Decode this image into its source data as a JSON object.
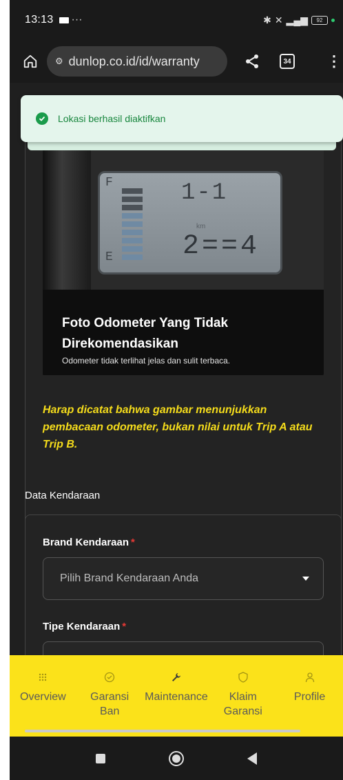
{
  "status_bar": {
    "time": "13:13",
    "battery": "92"
  },
  "browser": {
    "url": "dunlop.co.id/id/warranty",
    "tab_count": "34"
  },
  "toast": {
    "message": "Lokasi berhasil diaktifkan",
    "color": "#1a9b4b"
  },
  "photo_example": {
    "title": "Foto Odometer Yang Tidak Direkomendasikan",
    "description": "Odometer tidak terlihat jelas dan sulit terbaca.",
    "lcd_f": "F",
    "lcd_e": "E",
    "lcd_gear": "1-1",
    "lcd_unit": "km",
    "lcd_odo": "2==4"
  },
  "notice": "Harap dicatat bahwa gambar menunjukkan pembacaan odometer, bukan nilai untuk Trip A atau Trip B.",
  "vehicle_section": {
    "title": "Data Kendaraan",
    "brand_label": "Brand Kendaraan",
    "brand_placeholder": "Pilih Brand Kendaraan Anda",
    "type_label": "Tipe Kendaraan",
    "required_mark": "*"
  },
  "bottom_nav": {
    "items": [
      {
        "label": "Overview",
        "icon": "grid-icon"
      },
      {
        "label": "Garansi Ban",
        "icon": "check-circle-icon"
      },
      {
        "label": "Maintenance",
        "icon": "wrench-icon"
      },
      {
        "label": "Klaim Garansi",
        "icon": "shield-icon"
      },
      {
        "label": "Profile",
        "icon": "person-icon"
      }
    ],
    "background": "#fbe21a"
  },
  "accent_colors": {
    "notice": "#f5dc1b",
    "required": "#e53935"
  }
}
